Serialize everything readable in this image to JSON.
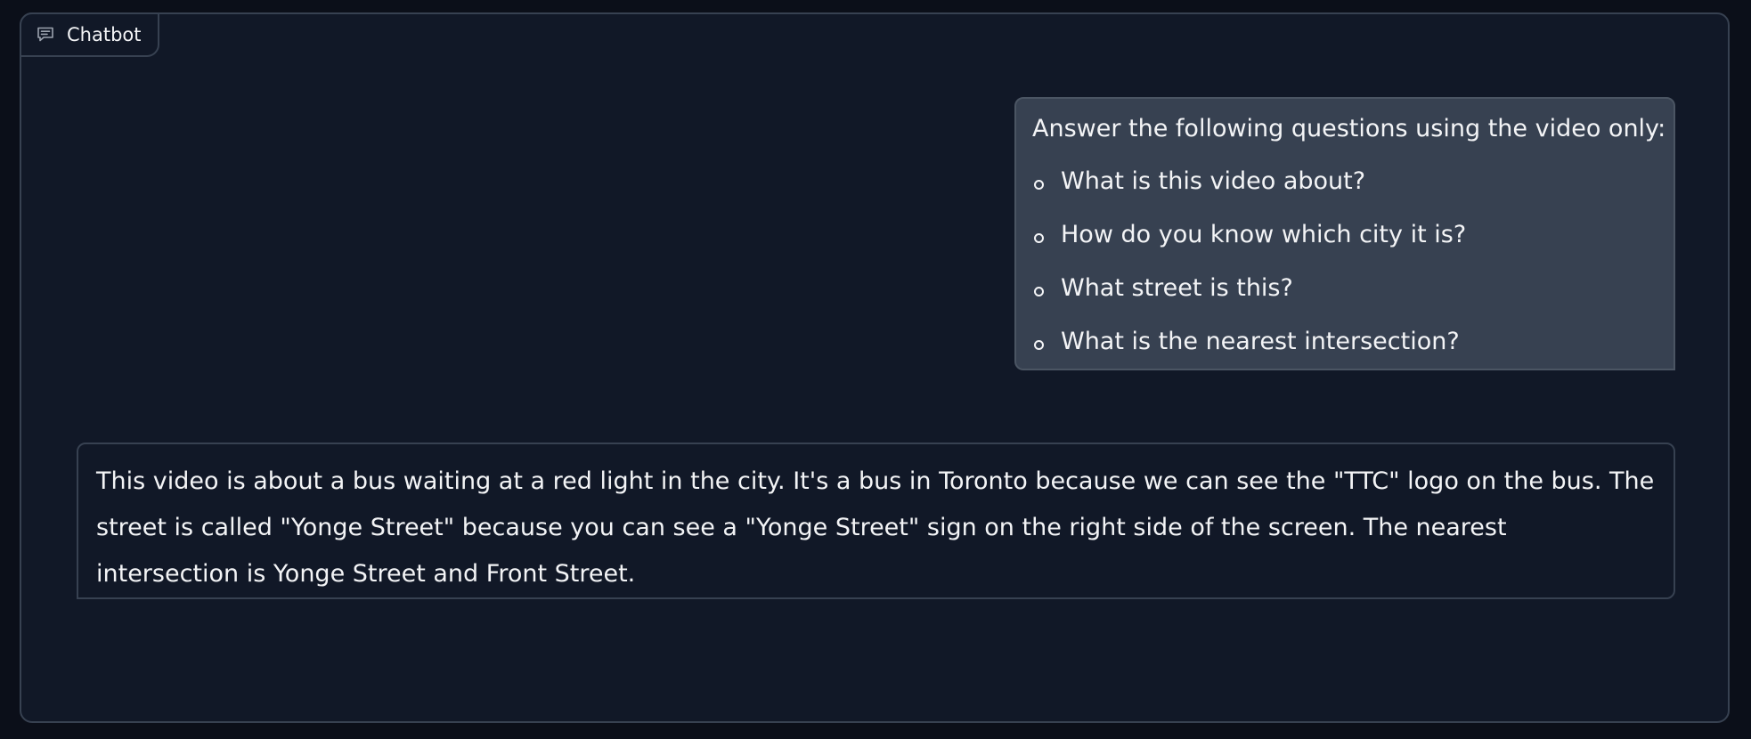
{
  "block": {
    "label": "Chatbot",
    "icon": "chat-bubble-icon"
  },
  "messages": {
    "user": {
      "intro": "Answer the following questions using the video only:",
      "questions": [
        "What is this video about?",
        "How do you know which city it is?",
        "What street is this?",
        "What is the nearest intersection?"
      ]
    },
    "bot": {
      "text": "This video is about a bus waiting at a red light in the city. It's a bus in Toronto because we can see the \"TTC\" logo on the bus. The street is called \"Yonge Street\" because you can see a \"Yonge Street\" sign on the right side of the screen. The nearest intersection is Yonge Street and Front Street."
    }
  },
  "colors": {
    "page_background": "#0b0f19",
    "panel_background": "#111827",
    "border": "#374151",
    "user_bubble": "#374151",
    "text": "#f3f4f6"
  }
}
